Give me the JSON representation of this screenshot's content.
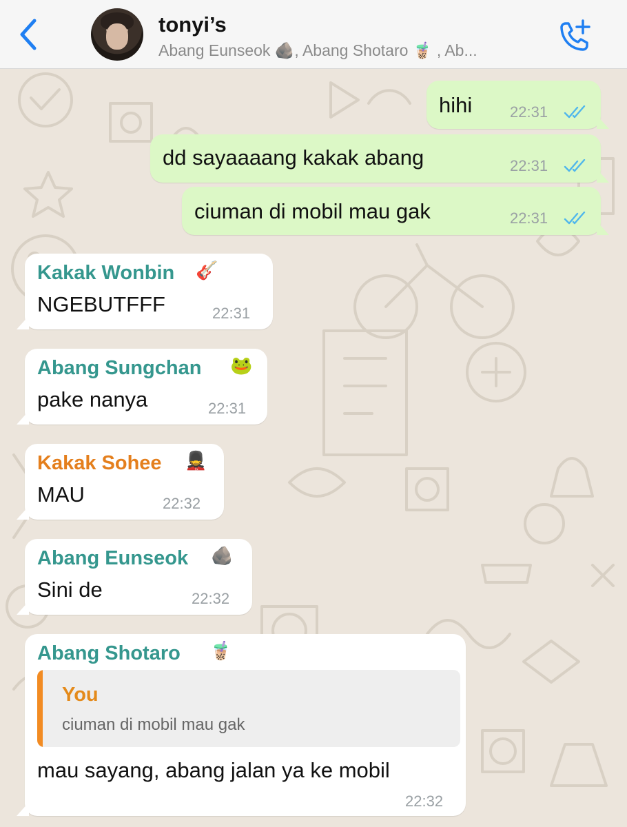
{
  "header": {
    "title": "tonyi’s",
    "subtitle": "Abang Eunseok 🪨, Abang Shotaro 🧋 , Ab..."
  },
  "messages": {
    "m1": {
      "text": "hihi",
      "time": "22:31",
      "status": "read"
    },
    "m2": {
      "text": "dd sayaaaang kakak abang",
      "time": "22:31",
      "status": "read"
    },
    "m3": {
      "text": "ciuman di mobil mau gak",
      "time": "22:31",
      "status": "read"
    },
    "m4": {
      "sender": "Kakak Wonbin",
      "sender_emoji": "🎸",
      "text": "NGEBUTFFF",
      "time": "22:31"
    },
    "m5": {
      "sender": "Abang Sungchan",
      "sender_emoji": "🐸",
      "text": "pake nanya",
      "time": "22:31"
    },
    "m6": {
      "sender": "Kakak Sohee",
      "sender_emoji": "💂",
      "text": "MAU",
      "time": "22:32"
    },
    "m7": {
      "sender": "Abang Eunseok",
      "sender_emoji": "🪨",
      "text": "Sini de",
      "time": "22:32"
    },
    "m8": {
      "sender": "Abang Shotaro",
      "sender_emoji": "🧋",
      "quote_author": "You",
      "quote_text": "ciuman di mobil mau gak",
      "text": "mau sayang, abang jalan ya ke mobil",
      "time": "22:32"
    }
  },
  "colors": {
    "accent_blue": "#1f7ff2",
    "outgoing_bubble": "#dcf8c6",
    "incoming_bubble": "#ffffff",
    "sender_teal": "#35978e",
    "sender_orange": "#e47f1d",
    "read_ticks": "#4fb6ec"
  },
  "icons": {
    "back": "chevron-left-icon",
    "call": "add-call-icon",
    "read_status": "double-check-icon"
  }
}
